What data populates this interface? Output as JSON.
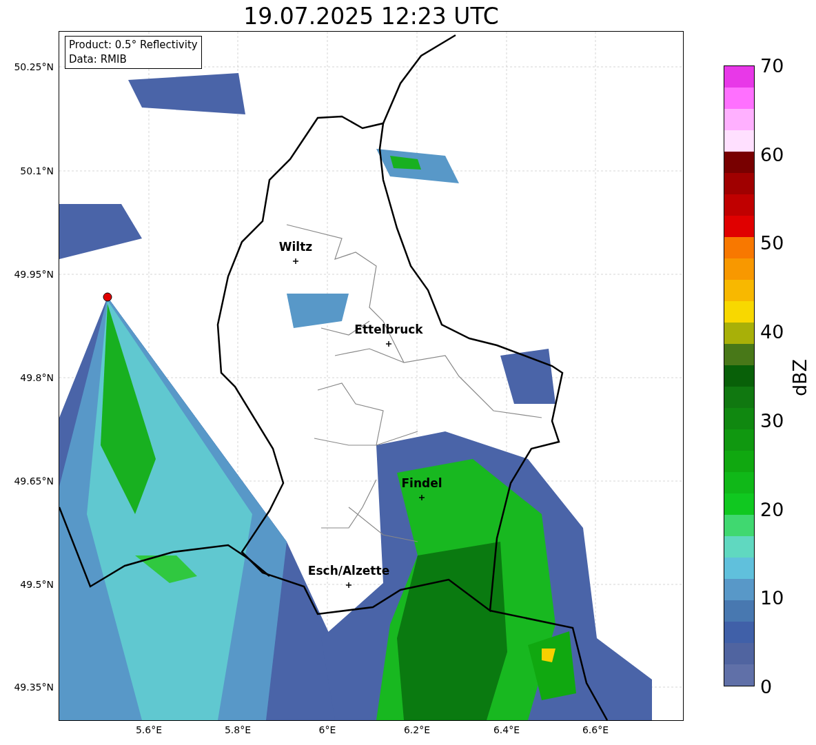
{
  "title": "19.07.2025 12:23 UTC",
  "legend": {
    "lines": [
      "Product: 0.5° Reflectivity",
      "Data: RMIB"
    ]
  },
  "y_ticks": [
    "50.25°N",
    "50.1°N",
    "49.95°N",
    "49.8°N",
    "49.65°N",
    "49.5°N",
    "49.35°N"
  ],
  "x_ticks": [
    "5.6°E",
    "5.8°E",
    "6°E",
    "6.2°E",
    "6.4°E",
    "6.6°E"
  ],
  "cities": [
    {
      "name": "Wiltz"
    },
    {
      "name": "Ettelbruck"
    },
    {
      "name": "Findel"
    },
    {
      "name": "Esch/Alzette"
    }
  ],
  "colorbar": {
    "label": "dBZ",
    "ticks": [
      "70",
      "60",
      "50",
      "40",
      "30",
      "20",
      "10",
      "0"
    ],
    "segments": [
      {
        "color": "#e838e8"
      },
      {
        "color": "#ff70ff"
      },
      {
        "color": "#ffb0ff"
      },
      {
        "color": "#ffe0ff"
      },
      {
        "color": "#780000"
      },
      {
        "color": "#a00000"
      },
      {
        "color": "#c00000"
      },
      {
        "color": "#e00000"
      },
      {
        "color": "#f87800"
      },
      {
        "color": "#f89800"
      },
      {
        "color": "#f8b800"
      },
      {
        "color": "#f8d800"
      },
      {
        "color": "#a8b008"
      },
      {
        "color": "#487818"
      },
      {
        "color": "#086008"
      },
      {
        "color": "#107810"
      },
      {
        "color": "#108810"
      },
      {
        "color": "#109810"
      },
      {
        "color": "#10a810"
      },
      {
        "color": "#10b818"
      },
      {
        "color": "#10c820"
      },
      {
        "color": "#40d870"
      },
      {
        "color": "#60d8c0"
      },
      {
        "color": "#60c0dc"
      },
      {
        "color": "#5898c8"
      },
      {
        "color": "#4878b0"
      },
      {
        "color": "#4060a8"
      },
      {
        "color": "#5064a0"
      },
      {
        "color": "#6070a8"
      }
    ]
  }
}
